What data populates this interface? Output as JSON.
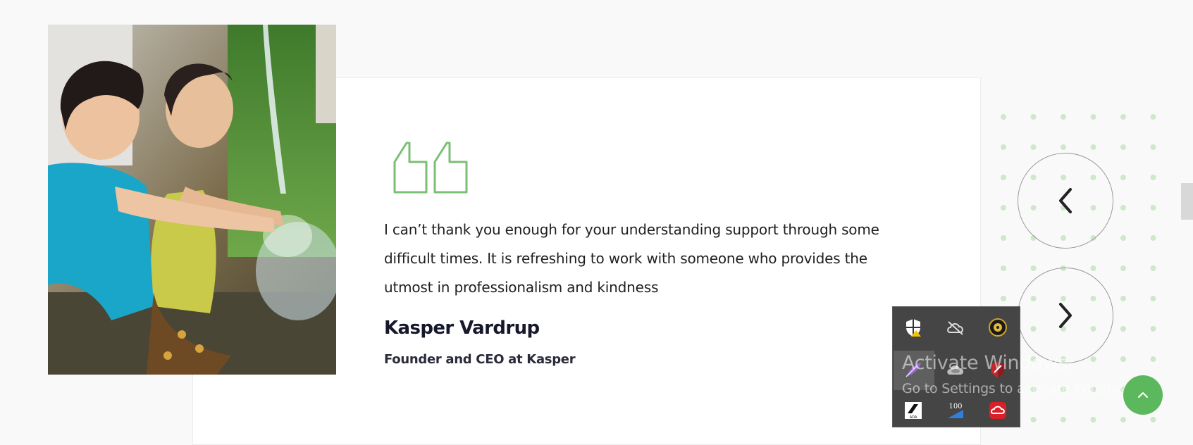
{
  "testimonial": {
    "quote": "I can’t thank you enough for your understanding support through some difficult times. It is refreshing to work with someone who provides the utmost in professionalism and kindness",
    "author": "Kasper Vardrup",
    "role": "Founder and CEO at Kasper",
    "image_alt": "Two children playing with splashing water"
  },
  "navigation": {
    "prev_icon": "chevron-left-icon",
    "next_icon": "chevron-right-icon",
    "to_top_icon": "chevron-up-icon"
  },
  "system_tray": {
    "icons": [
      "shield-warning-icon",
      "cloud-offline-icon",
      "speaker-icon",
      "feather-icon",
      "cloud-icon",
      "antivirus-icon",
      "autodesk-icon",
      "battery-100-icon",
      "creative-cloud-icon"
    ],
    "battery_label": "100",
    "autodesk_label": "ADA"
  },
  "watermark": {
    "title": "Activate Windows",
    "subtitle": "Go to Settings to activate Windows."
  },
  "colors": {
    "accent_green": "#5cb85c",
    "quote_icon_green": "#7bbf75",
    "dot_green": "#cde9c9",
    "text_dark": "#16182b"
  }
}
